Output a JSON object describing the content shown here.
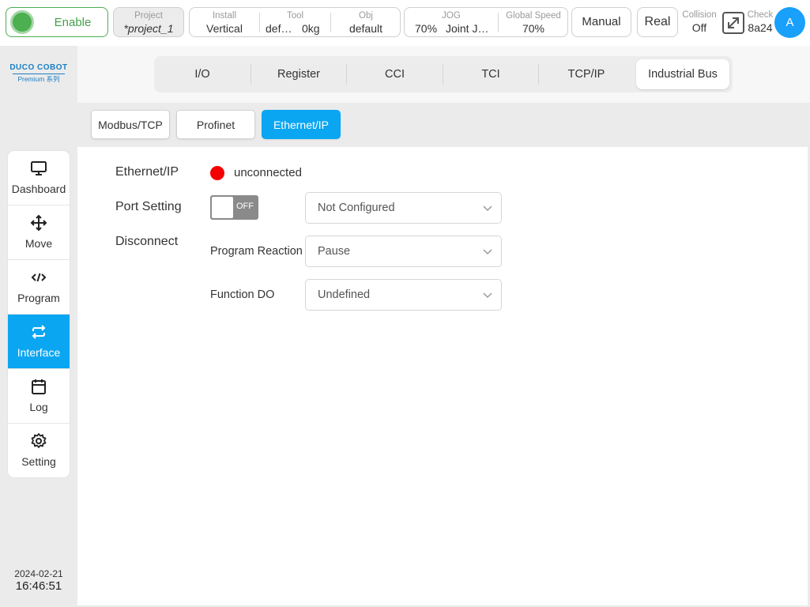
{
  "topbar": {
    "enable_label": "Enable",
    "project": {
      "caption": "Project",
      "value": "*project_1"
    },
    "install": {
      "caption": "Install",
      "value": "Vertical"
    },
    "tool": {
      "caption": "Tool",
      "name": "def…",
      "load": "0kg"
    },
    "obj": {
      "caption": "Obj",
      "value": "default"
    },
    "jog": {
      "caption": "JOG",
      "percent": "70%",
      "mode": "Joint J…"
    },
    "global_speed": {
      "caption": "Global Speed",
      "value": "70%"
    },
    "mode_button": "Manual",
    "real_button": "Real",
    "collision": {
      "caption": "Collision",
      "value": "Off"
    },
    "check": {
      "caption": "Check",
      "value": "8a24"
    },
    "avatar": "A"
  },
  "logo": {
    "brand": "DUCO COBOT",
    "series": "Premium 系列"
  },
  "sidebar": {
    "items": [
      {
        "label": "Dashboard",
        "icon": "monitor-icon"
      },
      {
        "label": "Move",
        "icon": "move-arrows-icon"
      },
      {
        "label": "Program",
        "icon": "code-icon"
      },
      {
        "label": "Interface",
        "icon": "interface-swap-icon"
      },
      {
        "label": "Log",
        "icon": "calendar-icon"
      },
      {
        "label": "Setting",
        "icon": "gear-icon"
      }
    ],
    "active": "Interface"
  },
  "clock": {
    "date": "2024-02-21",
    "time": "16:46:51"
  },
  "tabs": [
    "I/O",
    "Register",
    "CCI",
    "TCI",
    "TCP/IP",
    "Industrial Bus"
  ],
  "active_tab": "Industrial Bus",
  "subtabs": [
    "Modbus/TCP",
    "Profinet",
    "Ethernet/IP"
  ],
  "active_subtab": "Ethernet/IP",
  "form": {
    "status_label": "Ethernet/IP",
    "status_value": "unconnected",
    "status_color": "#f40000",
    "port_setting_label": "Port Setting",
    "toggle_text": "OFF",
    "port_select_value": "Not Configured",
    "disconnect_label": "Disconnect",
    "program_reaction_label": "Program Reaction",
    "program_reaction_value": "Pause",
    "function_do_label": "Function DO",
    "function_do_value": "Undefined"
  },
  "colors": {
    "accent": "#0aa6f2",
    "enable_green": "#4caf50",
    "avatar": "#18a0fb"
  }
}
